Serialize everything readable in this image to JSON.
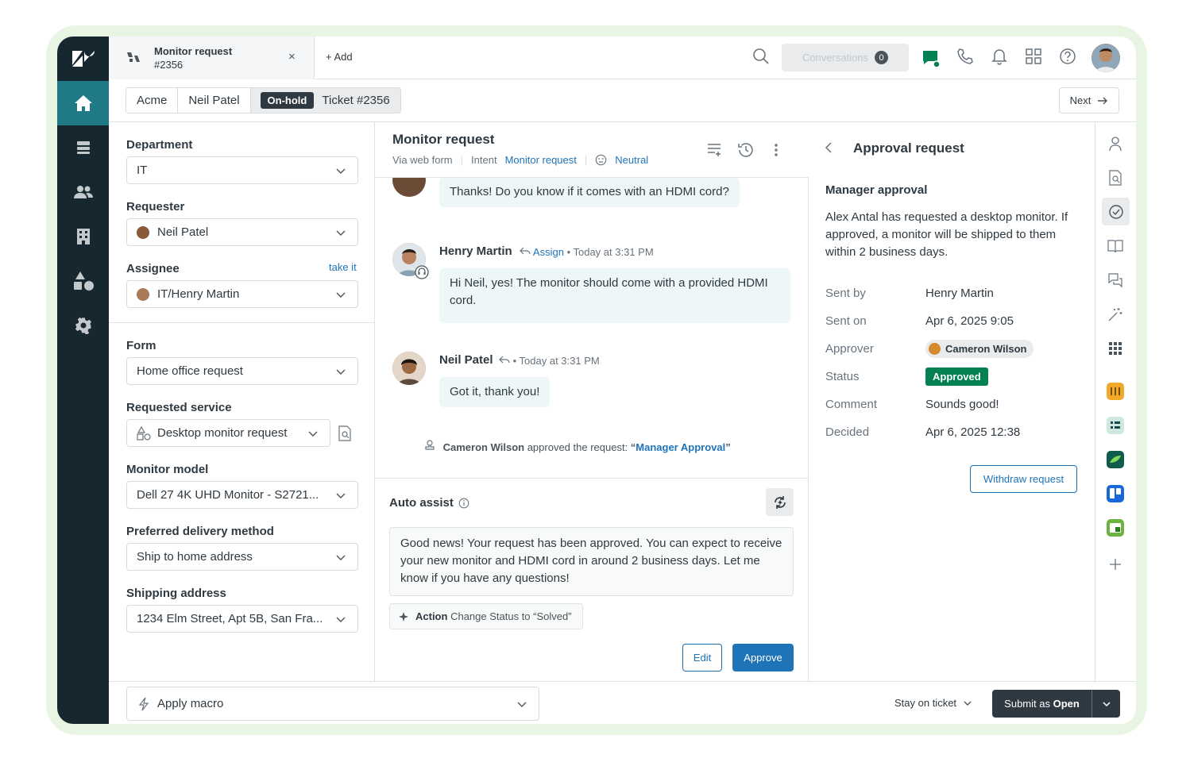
{
  "tab": {
    "title_line1": "Monitor request",
    "title_line2": "#2356",
    "close": "×",
    "add_label": "+ Add"
  },
  "topbar": {
    "conversations_label": "Conversations",
    "conversations_count": "0"
  },
  "breadcrumb": {
    "org": "Acme",
    "requester": "Neil Patel",
    "status_badge": "On-hold",
    "ticket": "Ticket #2356",
    "next_label": "Next"
  },
  "props": {
    "department": {
      "label": "Department",
      "value": "IT"
    },
    "requester": {
      "label": "Requester",
      "value": "Neil Patel"
    },
    "assignee": {
      "label": "Assignee",
      "value": "IT/Henry Martin",
      "take_it": "take it"
    },
    "form": {
      "label": "Form",
      "value": "Home office request"
    },
    "requested_service": {
      "label": "Requested service",
      "value": "Desktop monitor request"
    },
    "monitor_model": {
      "label": "Monitor model",
      "value": "Dell 27 4K UHD Monitor - S2721..."
    },
    "delivery": {
      "label": "Preferred delivery method",
      "value": "Ship to home address"
    },
    "shipping": {
      "label": "Shipping address",
      "value": "1234 Elm Street, Apt 5B, San Fra..."
    }
  },
  "conversation": {
    "title": "Monitor request",
    "channel": "Via web form",
    "intent_label": "Intent",
    "intent_value": "Monitor request",
    "sentiment": "Neutral",
    "messages": [
      {
        "text": "Thanks! Do you know if it comes with an HDMI cord?"
      },
      {
        "name": "Henry Martin",
        "assign": "Assign",
        "time": "• Today at 3:31 PM",
        "text": "Hi Neil, yes! The monitor should come with a provided HDMI cord."
      },
      {
        "name": "Neil Patel",
        "time": "• Today at 3:31 PM",
        "text": "Got it, thank you!"
      }
    ],
    "event": {
      "actor": "Cameron Wilson",
      "text": " approved the request: ",
      "quote_open": "“",
      "link": "Manager Approval",
      "quote_close": "”"
    }
  },
  "auto_assist": {
    "title": "Auto assist",
    "suggestion": "Good news! Your request has been approved. You can expect to receive your new monitor and HDMI cord in around 2 business days. Let me know if you have any questions!",
    "action_bold": "Action",
    "action_text": "Change Status to “Solved”",
    "edit_label": "Edit",
    "approve_label": "Approve"
  },
  "approval": {
    "title": "Approval request",
    "subtitle": "Manager approval",
    "description": "Alex Antal has requested a desktop monitor. If approved, a monitor will be shipped to them within 2 business days.",
    "rows": {
      "sent_by": {
        "label": "Sent by",
        "value": "Henry Martin"
      },
      "sent_on": {
        "label": "Sent on",
        "value": "Apr 6, 2025 9:05"
      },
      "approver": {
        "label": "Approver",
        "value": "Cameron Wilson"
      },
      "status": {
        "label": "Status",
        "value": "Approved"
      },
      "comment": {
        "label": "Comment",
        "value": "Sounds good!"
      },
      "decided": {
        "label": "Decided",
        "value": "Apr 6, 2025 12:38"
      }
    },
    "withdraw_label": "Withdraw request"
  },
  "footer": {
    "macro_placeholder": "Apply macro",
    "stay_label": "Stay on ticket",
    "submit_prefix": "Submit as ",
    "submit_status": "Open"
  },
  "colors": {
    "nav_bg": "#17272f",
    "nav_active": "#1f7a86",
    "link_blue": "#1f73b7",
    "approved_green": "#038153",
    "bubble": "#edf7f7",
    "halo": "#e9f5e3"
  }
}
